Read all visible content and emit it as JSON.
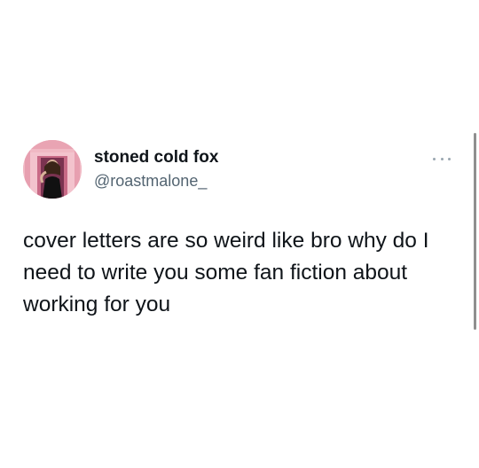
{
  "tweet": {
    "display_name": "stoned cold fox",
    "handle": "@roastmalone_",
    "text": "cover letters are so weird like bro why do I need to write you some fan fiction about working for you",
    "avatar_icon": "profile-photo",
    "more_icon": "more-options-icon"
  },
  "colors": {
    "text_primary": "#0f1419",
    "text_secondary": "#536471",
    "avatar_bg": "#efb7c2"
  }
}
